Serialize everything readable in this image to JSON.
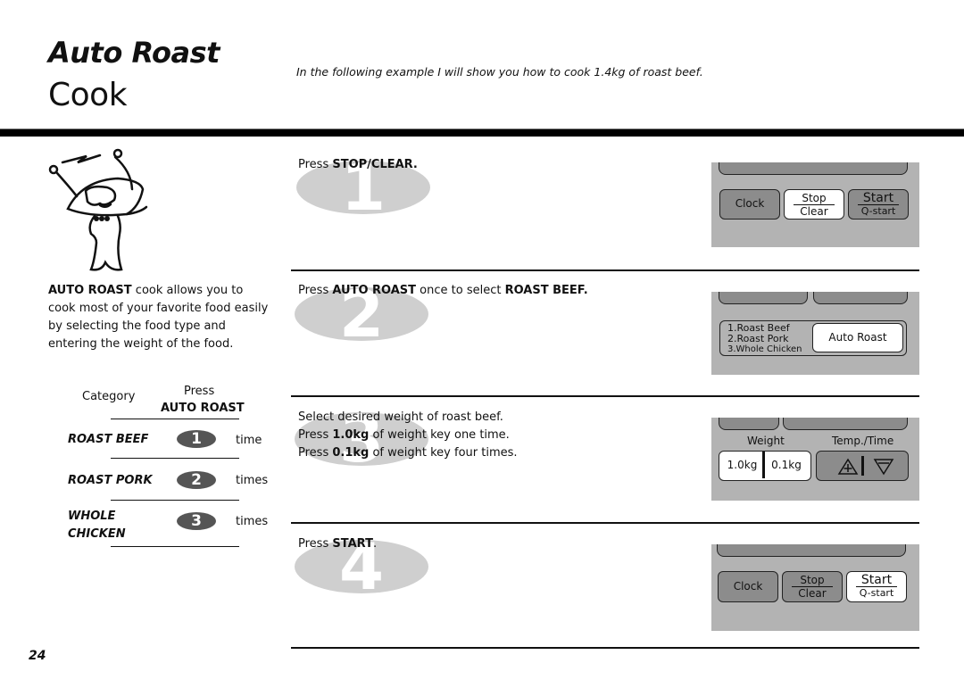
{
  "header": {
    "title_line1": "Auto Roast",
    "title_line2": "Cook",
    "intro": "In the following example I will show you how to cook 1.4kg of roast beef."
  },
  "description": {
    "bold": "AUTO ROAST",
    "rest": " cook allows you to cook most of your favorite food easily by selecting the food type and entering the weight of the food."
  },
  "table": {
    "col_category": "Category",
    "col_press": "Press",
    "col_press_key": "AUTO ROAST",
    "rows": [
      {
        "category": "ROAST BEEF",
        "presses": "1",
        "unit": "time"
      },
      {
        "category": "ROAST PORK",
        "presses": "2",
        "unit": "times"
      },
      {
        "category_line1": "WHOLE",
        "category_line2": "CHICKEN",
        "presses": "3",
        "unit": "times"
      }
    ]
  },
  "steps": [
    {
      "number": "1",
      "pre": "Press ",
      "bold": "STOP/CLEAR.",
      "post": ""
    },
    {
      "number": "2",
      "pre": "Press ",
      "bold": "AUTO ROAST",
      "mid": " once to select ",
      "bold2": "ROAST BEEF.",
      "post": ""
    },
    {
      "number": "3",
      "line1": "Select desired weight of roast beef.",
      "line2_pre": "Press ",
      "line2_bold": "1.0kg",
      "line2_post": " of weight key one time.",
      "line3_pre": "Press ",
      "line3_bold": "0.1kg",
      "line3_post": " of weight key four times."
    },
    {
      "number": "4",
      "pre": "Press ",
      "bold": "START",
      "post": "."
    }
  ],
  "panels": {
    "clock": "Clock",
    "stop": "Stop",
    "clear": "Clear",
    "start": "Start",
    "qstart": "Q-start",
    "menu_items": [
      "1.Roast Beef",
      "2.Roast Pork",
      "3.Whole Chicken"
    ],
    "auto_roast": "Auto Roast",
    "weight_label": "Weight",
    "temp_time_label": "Temp./Time",
    "weight_1kg": "1.0kg",
    "weight_01kg": "0.1kg",
    "up_icon": "triangle-up-plus-icon",
    "down_icon": "triangle-down-minus-icon"
  },
  "page_number": "24"
}
